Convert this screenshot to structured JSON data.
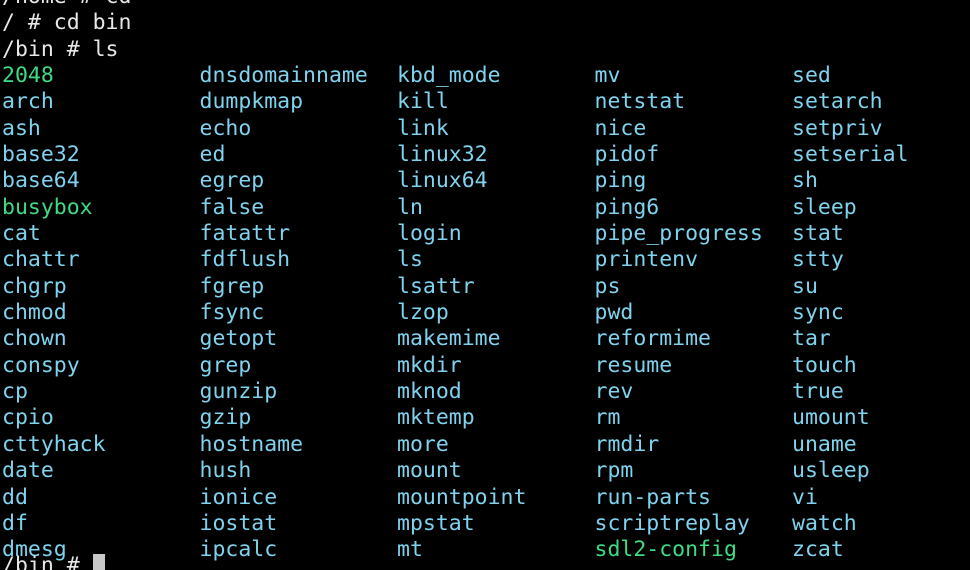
{
  "terminal": {
    "history": [
      "/home # cd",
      "/ # cd bin",
      "/bin # ls"
    ],
    "current_prompt": "/bin # ",
    "colors": {
      "background": "#000000",
      "text": "#e8e8e8",
      "link": "#7fd3ee",
      "executable": "#3ddc84"
    }
  },
  "listing": [
    {
      "name": "2048",
      "kind": "executable"
    },
    {
      "name": "arch",
      "kind": "link"
    },
    {
      "name": "ash",
      "kind": "link"
    },
    {
      "name": "base32",
      "kind": "link"
    },
    {
      "name": "base64",
      "kind": "link"
    },
    {
      "name": "busybox",
      "kind": "executable"
    },
    {
      "name": "cat",
      "kind": "link"
    },
    {
      "name": "chattr",
      "kind": "link"
    },
    {
      "name": "chgrp",
      "kind": "link"
    },
    {
      "name": "chmod",
      "kind": "link"
    },
    {
      "name": "chown",
      "kind": "link"
    },
    {
      "name": "conspy",
      "kind": "link"
    },
    {
      "name": "cp",
      "kind": "link"
    },
    {
      "name": "cpio",
      "kind": "link"
    },
    {
      "name": "cttyhack",
      "kind": "link"
    },
    {
      "name": "date",
      "kind": "link"
    },
    {
      "name": "dd",
      "kind": "link"
    },
    {
      "name": "df",
      "kind": "link"
    },
    {
      "name": "dmesg",
      "kind": "link"
    },
    {
      "name": "dnsdomainname",
      "kind": "link"
    },
    {
      "name": "dumpkmap",
      "kind": "link"
    },
    {
      "name": "echo",
      "kind": "link"
    },
    {
      "name": "ed",
      "kind": "link"
    },
    {
      "name": "egrep",
      "kind": "link"
    },
    {
      "name": "false",
      "kind": "link"
    },
    {
      "name": "fatattr",
      "kind": "link"
    },
    {
      "name": "fdflush",
      "kind": "link"
    },
    {
      "name": "fgrep",
      "kind": "link"
    },
    {
      "name": "fsync",
      "kind": "link"
    },
    {
      "name": "getopt",
      "kind": "link"
    },
    {
      "name": "grep",
      "kind": "link"
    },
    {
      "name": "gunzip",
      "kind": "link"
    },
    {
      "name": "gzip",
      "kind": "link"
    },
    {
      "name": "hostname",
      "kind": "link"
    },
    {
      "name": "hush",
      "kind": "link"
    },
    {
      "name": "ionice",
      "kind": "link"
    },
    {
      "name": "iostat",
      "kind": "link"
    },
    {
      "name": "ipcalc",
      "kind": "link"
    },
    {
      "name": "kbd_mode",
      "kind": "link"
    },
    {
      "name": "kill",
      "kind": "link"
    },
    {
      "name": "link",
      "kind": "link"
    },
    {
      "name": "linux32",
      "kind": "link"
    },
    {
      "name": "linux64",
      "kind": "link"
    },
    {
      "name": "ln",
      "kind": "link"
    },
    {
      "name": "login",
      "kind": "link"
    },
    {
      "name": "ls",
      "kind": "link"
    },
    {
      "name": "lsattr",
      "kind": "link"
    },
    {
      "name": "lzop",
      "kind": "link"
    },
    {
      "name": "makemime",
      "kind": "link"
    },
    {
      "name": "mkdir",
      "kind": "link"
    },
    {
      "name": "mknod",
      "kind": "link"
    },
    {
      "name": "mktemp",
      "kind": "link"
    },
    {
      "name": "more",
      "kind": "link"
    },
    {
      "name": "mount",
      "kind": "link"
    },
    {
      "name": "mountpoint",
      "kind": "link"
    },
    {
      "name": "mpstat",
      "kind": "link"
    },
    {
      "name": "mt",
      "kind": "link"
    },
    {
      "name": "mv",
      "kind": "link"
    },
    {
      "name": "netstat",
      "kind": "link"
    },
    {
      "name": "nice",
      "kind": "link"
    },
    {
      "name": "pidof",
      "kind": "link"
    },
    {
      "name": "ping",
      "kind": "link"
    },
    {
      "name": "ping6",
      "kind": "link"
    },
    {
      "name": "pipe_progress",
      "kind": "link"
    },
    {
      "name": "printenv",
      "kind": "link"
    },
    {
      "name": "ps",
      "kind": "link"
    },
    {
      "name": "pwd",
      "kind": "link"
    },
    {
      "name": "reformime",
      "kind": "link"
    },
    {
      "name": "resume",
      "kind": "link"
    },
    {
      "name": "rev",
      "kind": "link"
    },
    {
      "name": "rm",
      "kind": "link"
    },
    {
      "name": "rmdir",
      "kind": "link"
    },
    {
      "name": "rpm",
      "kind": "link"
    },
    {
      "name": "run-parts",
      "kind": "link"
    },
    {
      "name": "scriptreplay",
      "kind": "link"
    },
    {
      "name": "sdl2-config",
      "kind": "executable"
    },
    {
      "name": "sed",
      "kind": "link"
    },
    {
      "name": "setarch",
      "kind": "link"
    },
    {
      "name": "setpriv",
      "kind": "link"
    },
    {
      "name": "setserial",
      "kind": "link"
    },
    {
      "name": "sh",
      "kind": "link"
    },
    {
      "name": "sleep",
      "kind": "link"
    },
    {
      "name": "stat",
      "kind": "link"
    },
    {
      "name": "stty",
      "kind": "link"
    },
    {
      "name": "su",
      "kind": "link"
    },
    {
      "name": "sync",
      "kind": "link"
    },
    {
      "name": "tar",
      "kind": "link"
    },
    {
      "name": "touch",
      "kind": "link"
    },
    {
      "name": "true",
      "kind": "link"
    },
    {
      "name": "umount",
      "kind": "link"
    },
    {
      "name": "uname",
      "kind": "link"
    },
    {
      "name": "usleep",
      "kind": "link"
    },
    {
      "name": "vi",
      "kind": "link"
    },
    {
      "name": "watch",
      "kind": "link"
    },
    {
      "name": "zcat",
      "kind": "link"
    }
  ]
}
